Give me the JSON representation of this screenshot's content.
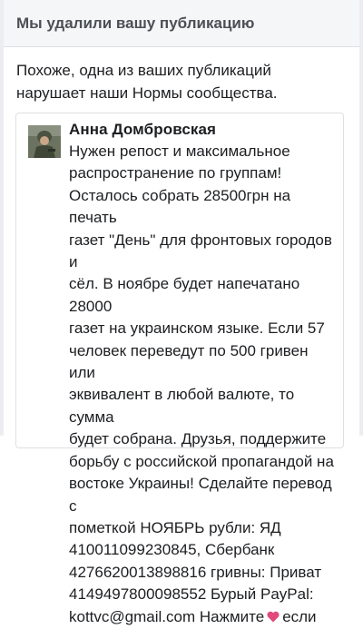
{
  "header": {
    "title": "Мы удалили вашу публикацию"
  },
  "notice": {
    "text": "Похоже, одна из ваших публикаций нарушает наши Нормы сообщества."
  },
  "post": {
    "author": "Анна Домбровская",
    "text_before_heart": "Нужен репост и максимальное\nраспространение по группам!\nОсталось собрать 28500грн на печать\nгазет \"День\" для фронтовых городов и\nсёл. В ноябре будет напечатано 28000\nгазет на украинском языке. Если 57\nчеловек переведут по 500 гривен или\nэквивалент в любой валюте, то сумма\nбудет собрана. Друзья, поддержите\nборьбу с российской пропагандой на\nвостоке Украины! Сделайте перевод с\nпометкой НОЯБРЬ рубли: ЯД\n410011099230845, Сбербанк\n4276620013898816 гривны: Приват\n4149497800098552 Бурый PayPal:\nkottvc@gmail.com Нажмите",
    "heart_icon": "heart-icon",
    "text_after_heart": "если"
  },
  "colors": {
    "header_bg": "#f5f6f7",
    "heart": "#e2497a"
  }
}
